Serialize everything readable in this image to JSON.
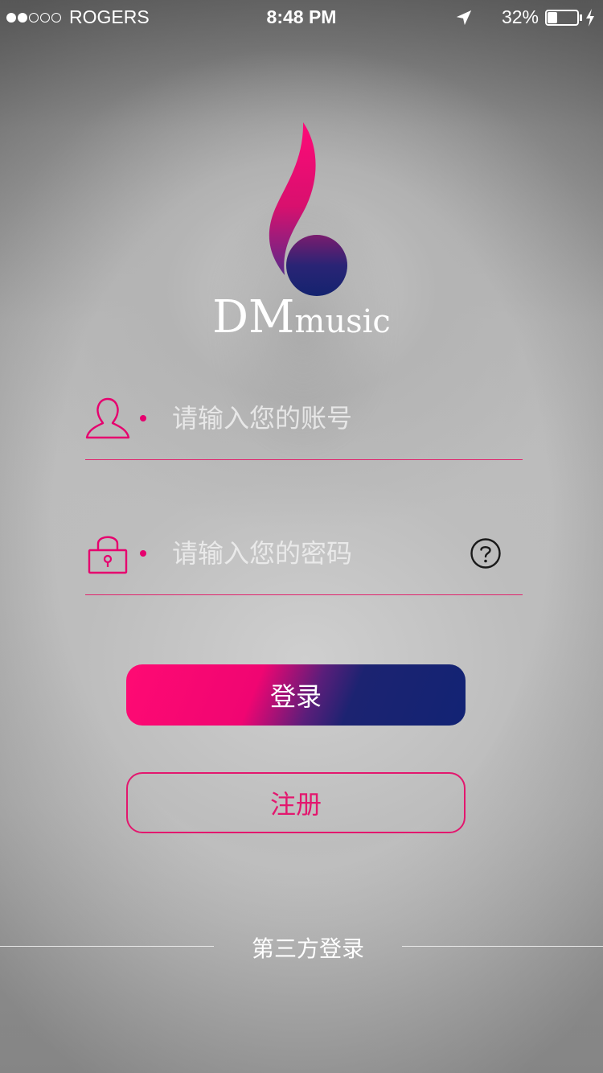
{
  "status_bar": {
    "carrier": "ROGERS",
    "time": "8:48 PM",
    "battery_percent": "32%",
    "battery_level": 0.32,
    "signal_bars_total": 5,
    "signal_bars_filled": 2,
    "icons": [
      "location-arrow-icon",
      "battery-icon",
      "charging-bolt-icon"
    ]
  },
  "logo": {
    "text_big": "DM",
    "text_small": "music"
  },
  "account_field": {
    "placeholder": "请输入您的账号",
    "value": "",
    "icon": "user-icon"
  },
  "password_field": {
    "placeholder": "请输入您的密码",
    "value": "",
    "icon": "lock-icon",
    "help_icon": "question-circle-icon"
  },
  "buttons": {
    "login": "登录",
    "register": "注册"
  },
  "third_party": {
    "label": "第三方登录"
  },
  "colors": {
    "accent_pink": "#e6006e",
    "accent_navy": "#122374",
    "text": "#ffffff"
  }
}
